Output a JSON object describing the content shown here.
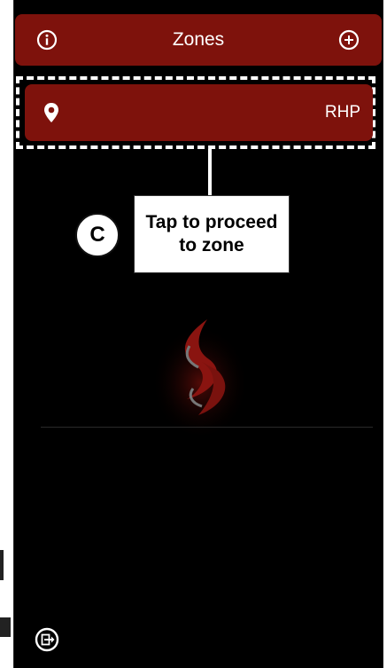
{
  "header": {
    "title": "Zones",
    "info_icon": "info-icon",
    "add_icon": "plus-circle-icon"
  },
  "zones": [
    {
      "name": "RHP",
      "icon": "location-pin-icon"
    }
  ],
  "annotation": {
    "badge": "C",
    "callout_text": "Tap to proceed to zone"
  },
  "footer": {
    "logout_icon": "logout-icon"
  },
  "colors": {
    "background": "#000000",
    "accent": "#7e120c",
    "text": "#ffffff"
  }
}
